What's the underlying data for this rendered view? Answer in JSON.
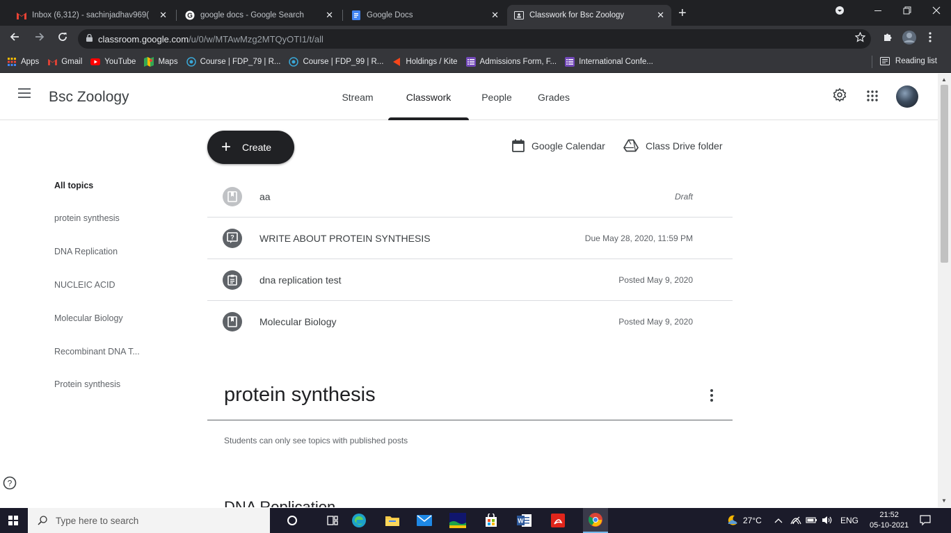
{
  "browser": {
    "tabs": [
      {
        "title": "Inbox (6,312) - sachinjadhav969(",
        "icon": "gmail-icon"
      },
      {
        "title": "google docs - Google Search",
        "icon": "google-icon"
      },
      {
        "title": "Google Docs",
        "icon": "docs-icon"
      },
      {
        "title": "Classwork for Bsc Zoology",
        "icon": "classroom-icon",
        "active": true
      }
    ],
    "close_glyph": "✕",
    "new_tab_glyph": "+",
    "url_host": "classroom.google.com",
    "url_path": "/u/0/w/MTAwMzg2MTQyOTI1/t/all",
    "bookmarks": [
      {
        "label": "Apps",
        "icon": "apps-grid-icon"
      },
      {
        "label": "Gmail",
        "icon": "gmail-icon"
      },
      {
        "label": "YouTube",
        "icon": "youtube-icon"
      },
      {
        "label": "Maps",
        "icon": "maps-icon"
      },
      {
        "label": "Course | FDP_79 | R...",
        "icon": "course-icon"
      },
      {
        "label": "Course | FDP_99 | R...",
        "icon": "course-icon"
      },
      {
        "label": "Holdings / Kite",
        "icon": "kite-icon"
      },
      {
        "label": "Admissions Form, F...",
        "icon": "forms-icon"
      },
      {
        "label": "International Confe...",
        "icon": "forms-icon"
      }
    ],
    "reading_list": "Reading list"
  },
  "classroom": {
    "class_name": "Bsc Zoology",
    "nav_tabs": [
      {
        "label": "Stream"
      },
      {
        "label": "Classwork",
        "active": true
      },
      {
        "label": "People"
      },
      {
        "label": "Grades"
      }
    ],
    "create_label": "Create",
    "google_calendar": "Google Calendar",
    "drive_folder": "Class Drive folder",
    "topics": [
      "All topics",
      "protein synthesis",
      "DNA Replication",
      "NUCLEIC ACID",
      "Molecular Biology",
      "Recombinant DNA T...",
      "Protein synthesis"
    ],
    "items": [
      {
        "title": "aa",
        "meta": "Draft",
        "icon": "material-icon",
        "draft": true
      },
      {
        "title": "WRITE ABOUT PROTEIN SYNTHESIS",
        "meta": "Due May 28, 2020, 11:59 PM",
        "icon": "question-icon"
      },
      {
        "title": "dna replication test",
        "meta": "Posted May 9, 2020",
        "icon": "assignment-icon"
      },
      {
        "title": "Molecular Biology",
        "meta": "Posted May 9, 2020",
        "icon": "material-icon"
      }
    ],
    "section_title": "protein synthesis",
    "section_note": "Students can only see topics with published posts",
    "next_section_peek": "DNA Replication"
  },
  "taskbar": {
    "search_placeholder": "Type here to search",
    "weather": "27°C",
    "language": "ENG",
    "time": "21:52",
    "date": "05-10-2021"
  },
  "colors": {
    "accent": "#202124",
    "chrome_dark": "#202124",
    "chrome_toolbar": "#35363a",
    "taskbar": "#1b1b2a"
  }
}
